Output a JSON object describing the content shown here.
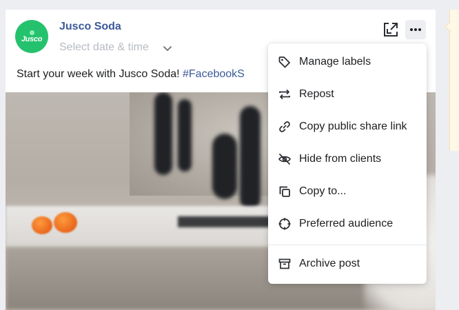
{
  "post": {
    "account_name": "Jusco Soda",
    "avatar_text": "Jusco",
    "date_placeholder": "Select date & time",
    "caption_text": "Start your week with Jusco Soda! ",
    "caption_hashtag": "#FacebookS"
  },
  "actions": {
    "expand_icon": "expand-icon",
    "more_icon": "more-icon"
  },
  "menu": {
    "items": [
      {
        "label": "Manage labels",
        "icon": "tag-icon"
      },
      {
        "label": "Repost",
        "icon": "repost-icon"
      },
      {
        "label": "Copy public share link",
        "icon": "link-icon"
      },
      {
        "label": "Hide from clients",
        "icon": "eye-off-icon"
      },
      {
        "label": "Copy to...",
        "icon": "copy-icon"
      },
      {
        "label": "Preferred audience",
        "icon": "target-icon"
      },
      {
        "label": "Archive post",
        "icon": "archive-icon"
      }
    ]
  },
  "colors": {
    "brand_green": "#25c26e",
    "link_blue": "#3b5998",
    "background": "#eceef2"
  }
}
